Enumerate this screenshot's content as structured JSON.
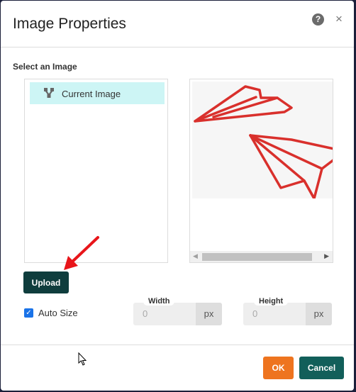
{
  "dialog": {
    "title": "Image Properties",
    "help_icon": "?",
    "close_icon": "×"
  },
  "image_select": {
    "section_label": "Select an Image",
    "items": [
      {
        "label": "Current Image",
        "icon": "tree-icon",
        "selected": true
      }
    ]
  },
  "preview": {
    "description": "Two red paper airplanes sketch"
  },
  "upload_label": "Upload",
  "auto_size": {
    "label": "Auto Size",
    "checked": true,
    "check_glyph": "✓"
  },
  "width_field": {
    "label": "Width",
    "value": "0",
    "unit": "px"
  },
  "height_field": {
    "label": "Height",
    "value": "0",
    "unit": "px"
  },
  "footer": {
    "ok_label": "OK",
    "cancel_label": "Cancel"
  },
  "colors": {
    "upload_bg": "#0f3d3d",
    "ok_bg": "#ee741f",
    "cancel_bg": "#125f5a",
    "selected_item_bg": "#cdf5f5",
    "checkbox": "#1a73e8"
  }
}
